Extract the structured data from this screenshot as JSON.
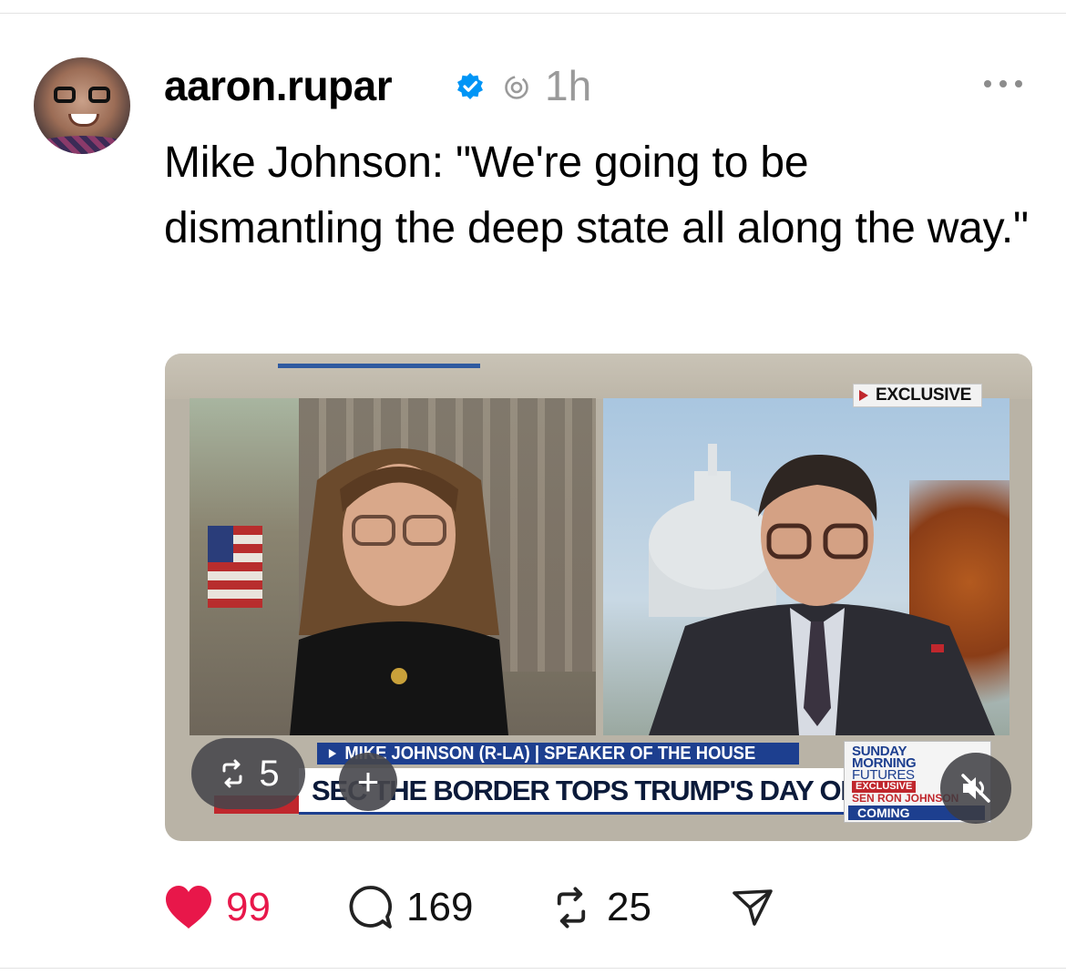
{
  "post": {
    "username": "aaron.rupar",
    "time": "1h",
    "text": "Mike Johnson: \"We're going to be dismantling the deep state all along the way.\""
  },
  "video": {
    "exclusive_label": "EXCLUSIVE",
    "chyron_name": "MIKE JOHNSON (R-LA) | SPEAKER OF THE HOUSE",
    "chyron_headline": "SEC      THE BORDER TOPS TRUMP'S DAY ONE AGENDA",
    "show_lines": [
      "SUNDAY",
      "MORNING",
      "FUTURES"
    ],
    "show_exclusive": "EXCLUSIVE",
    "show_guest": "SEN RON JOHNSON",
    "show_coming": "COMING",
    "repost_count": "5"
  },
  "actions": {
    "likes": "99",
    "replies": "169",
    "reposts": "25"
  },
  "colors": {
    "like": "#e8174a",
    "verified": "#0095f6",
    "chyron_blue": "#1d3f8f",
    "fox_red": "#c0272d"
  },
  "icons": [
    "verified-icon",
    "threads-icon",
    "more-icon",
    "repost-icon",
    "plus-icon",
    "mute-icon",
    "heart-icon",
    "comment-icon",
    "share-icon"
  ]
}
